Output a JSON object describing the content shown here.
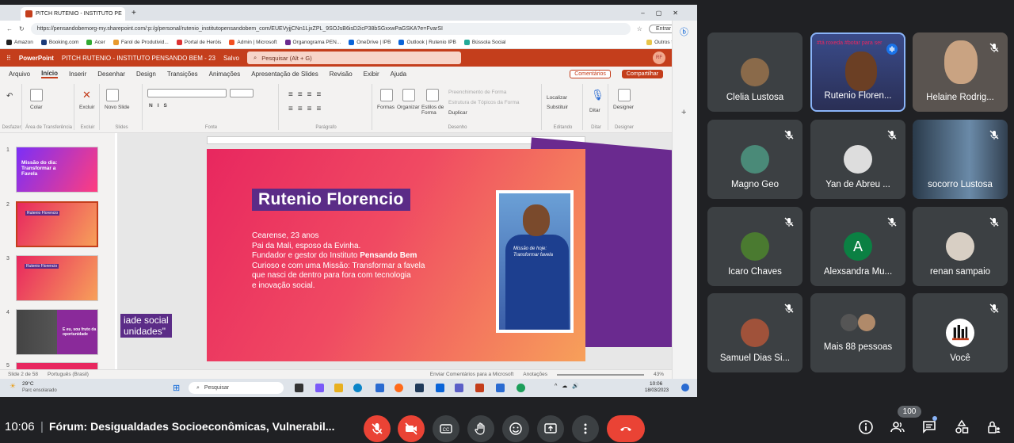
{
  "browser": {
    "tab_title": "PITCH RUTENIO - INSTITUTO PE",
    "url": "https://pensandobemorg-my.sharepoint.com/:p:/g/personal/rutenio_institutopensandobem_com/EUEVyjjCNn1LjxZPL_9SOJsB6isD2icP38bSGxxwPaGSKA?e=FvarSI",
    "entrar_label": "Entrar",
    "favorites": [
      "Amazon",
      "Booking.com",
      "Acer",
      "Farol de Produtivid...",
      "Portal de Heróis",
      "Admin | Microsoft",
      "Organograma PEN...",
      "OneDrive | IPB",
      "Outlook | Rutenio IPB",
      "Bússola Social",
      "Outros favoritos"
    ]
  },
  "ppt": {
    "app_name": "PowerPoint",
    "doc_title": "PITCH RUTENIO - INSTITUTO PENSANDO BEM - 23",
    "saved": "Salvo",
    "search_placeholder": "Pesquisar (Alt + G)",
    "user_initials": "RF",
    "menu": [
      "Arquivo",
      "Início",
      "Inserir",
      "Desenhar",
      "Design",
      "Transições",
      "Animações",
      "Apresentação de Slides",
      "Revisão",
      "Exibir",
      "Ajuda"
    ],
    "comments_label": "Comentários",
    "share_label": "Compartilhar",
    "ribbon": {
      "desfazer": "Desfazer",
      "colar": "Colar",
      "area": "Área de Transferência",
      "excluir": "Excluir",
      "excluir_grp": "Excluir",
      "novo_slide": "Novo Slide",
      "slides": "Slides",
      "fonte": "Fonte",
      "paragrafo": "Parágrafo",
      "formas": "Formas",
      "organizar": "Organizar",
      "estilos": "Estilos de Forma",
      "preenchimento": "Preenchimento de Forma",
      "estrutura": "Estrutura de Tópicos da Forma",
      "duplicar": "Duplicar",
      "desenho": "Desenho",
      "localizar": "Localizar",
      "substituir": "Substituir",
      "editando": "Editando",
      "ditar": "Ditar",
      "ditar_grp": "Ditar",
      "designer": "Designer",
      "designer_grp": "Designer"
    },
    "thumbs": [
      {
        "num": "1",
        "text": "Missão do dia: Transformar a Favela"
      },
      {
        "num": "2",
        "text": "Rutenio Florencio"
      },
      {
        "num": "3",
        "text": "Rutenio Florencio"
      },
      {
        "num": "4",
        "text": "E eu, sou fruto da oportunidade"
      },
      {
        "num": "5",
        "text": ""
      }
    ],
    "slide": {
      "title": "Rutenio Florencio",
      "line1": "Cearense, 23 anos",
      "line2": "Pai da Mali, esposo da Evinha.",
      "line3a": "Fundador e gestor do Instituto ",
      "line3b": "Pensando Bem",
      "line4": "Curioso e com uma Missão: Transformar a favela",
      "line5": "que nasci de dentro para fora com tecnologia",
      "line6": "e inovação social.",
      "side1": "iade social",
      "side2": "unidades\"",
      "shirt": "Missão de hoje: Transformar favela"
    },
    "status": {
      "slide_of": "Slide 2 de 58",
      "lang": "Português (Brasil)",
      "feedback": "Enviar Comentários para a Microsoft",
      "notes": "Anotações",
      "zoom": "43%"
    }
  },
  "taskbar": {
    "weather_temp": "29°C",
    "weather_desc": "Parc ensolarado",
    "search": "Pesquisar",
    "time": "10:06",
    "date": "18/03/2023"
  },
  "participants": [
    {
      "name": "Clelia Lustosa",
      "muted": false
    },
    {
      "name": "Rutenio Floren...",
      "muted": false,
      "speaking": true
    },
    {
      "name": "Helaine Rodrig...",
      "muted": true
    },
    {
      "name": "Magno Geo",
      "muted": true
    },
    {
      "name": "Yan de Abreu ...",
      "muted": true
    },
    {
      "name": "socorro Lustosa",
      "muted": true
    },
    {
      "name": "Ícaro Chaves",
      "muted": true
    },
    {
      "name": "Alexsandra Mu...",
      "muted": true,
      "initial": "A"
    },
    {
      "name": "renan sampaio",
      "muted": true
    },
    {
      "name": "Samuel Dias Si...",
      "muted": true
    },
    {
      "name": "Mais 88 pessoas",
      "muted": false
    },
    {
      "name": "Você",
      "muted": true
    }
  ],
  "meeting": {
    "time": "10:06",
    "title": "Fórum: Desigualdades Socioeconômicas, Vulnerabil...",
    "people_count": "100"
  },
  "colors": {
    "ppt_red": "#c43e1c",
    "slide_purple": "#5b2c87",
    "end_call": "#ea4335",
    "alexsandra": "#0b8043"
  }
}
